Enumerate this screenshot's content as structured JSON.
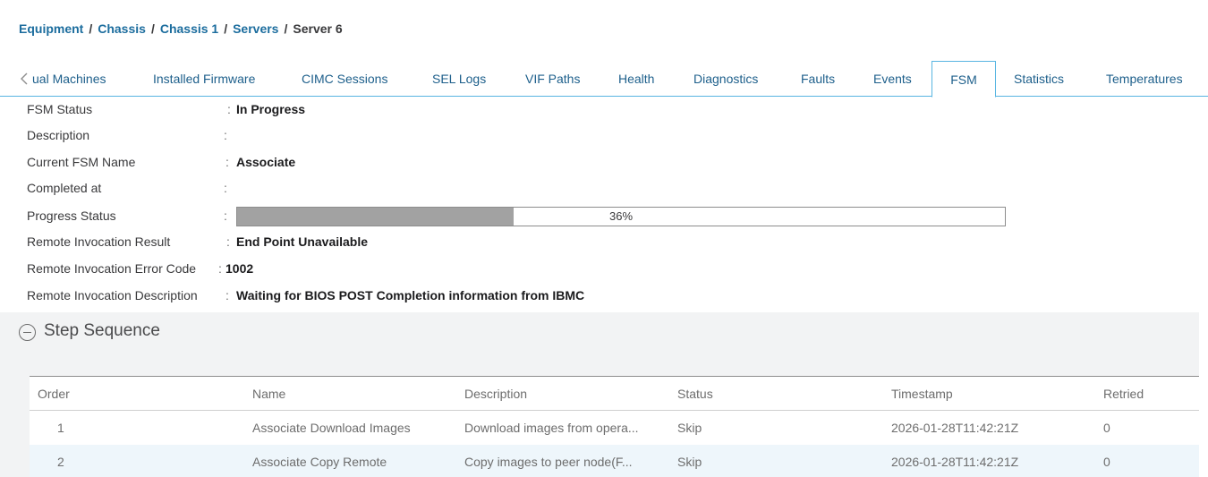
{
  "breadcrumb": {
    "items": [
      "Equipment",
      "Chassis",
      "Chassis 1",
      "Servers"
    ],
    "current": "Server 6",
    "separator": "/"
  },
  "tabs": [
    {
      "label": "ual Machines"
    },
    {
      "label": "Installed Firmware"
    },
    {
      "label": "CIMC Sessions"
    },
    {
      "label": "SEL Logs"
    },
    {
      "label": "VIF Paths"
    },
    {
      "label": "Health"
    },
    {
      "label": "Diagnostics"
    },
    {
      "label": "Faults"
    },
    {
      "label": "Events"
    },
    {
      "label": "FSM",
      "active": true
    },
    {
      "label": "Statistics"
    },
    {
      "label": "Temperatures"
    }
  ],
  "fsm": {
    "fsm_status_label": "FSM Status",
    "fsm_status_value": "In Progress",
    "description_label": "Description",
    "description_value": "",
    "current_fsm_name_label": "Current FSM Name",
    "current_fsm_name_value": "Associate",
    "completed_at_label": "Completed at",
    "completed_at_value": "",
    "progress_status_label": "Progress Status",
    "progress_percent": 36,
    "progress_text": "36%",
    "remote_result_label": "Remote Invocation Result",
    "remote_result_value": "End Point Unavailable",
    "remote_error_code_label": "Remote Invocation Error Code",
    "remote_error_code_value": "1002",
    "remote_description_label": "Remote Invocation Description",
    "remote_description_value": "Waiting for BIOS POST Completion information from IBMC",
    "colon": ":"
  },
  "step_sequence": {
    "title": "Step Sequence",
    "columns": [
      "Order",
      "Name",
      "Description",
      "Status",
      "Timestamp",
      "Retried"
    ],
    "rows": [
      {
        "order": "1",
        "name": "Associate Download Images",
        "description": "Download images from opera...",
        "status": "Skip",
        "timestamp": "2026-01-28T11:42:21Z",
        "retried": "0"
      },
      {
        "order": "2",
        "name": "Associate Copy Remote",
        "description": "Copy images to peer node(F...",
        "status": "Skip",
        "timestamp": "2026-01-28T11:42:21Z",
        "retried": "0"
      }
    ]
  },
  "colors": {
    "link": "#1c6d9e",
    "tab_border": "#58b5e1",
    "progress_fill": "#a2a2a2",
    "panel_bg": "#f2f3f4",
    "row_alt": "#eef6fb"
  }
}
